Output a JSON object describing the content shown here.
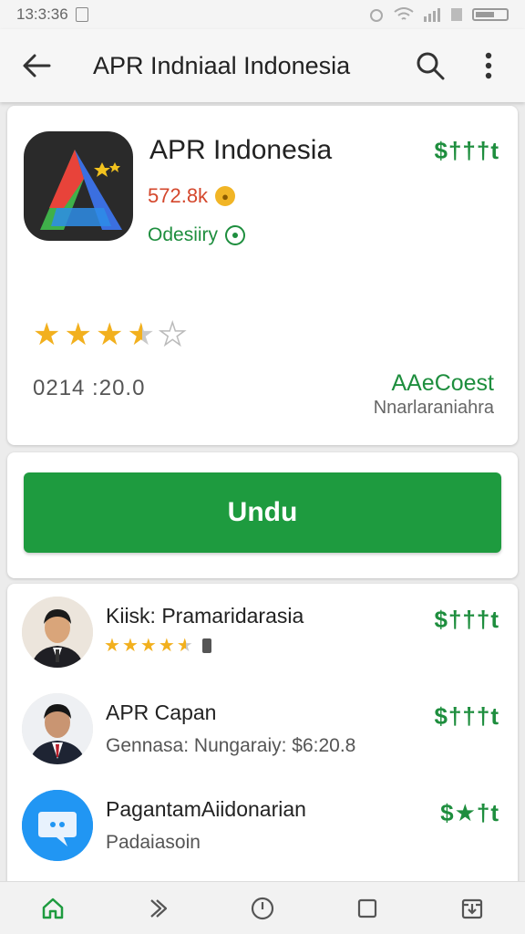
{
  "status_bar": {
    "time": "13:3:36"
  },
  "app_bar": {
    "title": "APR Indniaal Indonesia",
    "back_icon": "arrow-left-icon",
    "search_icon": "search-icon",
    "more_icon": "more-vert-icon"
  },
  "app": {
    "name": "APR Indonesia",
    "downloads": "572.8k",
    "developer": "Odesiiry",
    "price": "$†††t",
    "rating": 3.5,
    "version": "0214 :20.0",
    "cost_label": "AAeCoest",
    "publisher": "Nnarlaraniahra"
  },
  "install": {
    "label": "Undu"
  },
  "list": [
    {
      "title": "Kiisk: Pramaridarasia",
      "price": "$†††t",
      "rating": 4.5
    },
    {
      "title": "APR Capan",
      "subtitle": "Gennasa:  Nungaraiy: $6:20.8",
      "price": "$†††t"
    },
    {
      "title": "PagantamAiidonarian",
      "subtitle": "Padaiasoin",
      "price": "$★†t"
    }
  ],
  "nav": {
    "items": [
      "home-icon",
      "forward-icon",
      "clock-icon",
      "square-icon",
      "download-icon"
    ]
  },
  "colors": {
    "accent_green": "#1e9b3f",
    "star_gold": "#f2b01e",
    "downloads_red": "#d4472c"
  }
}
